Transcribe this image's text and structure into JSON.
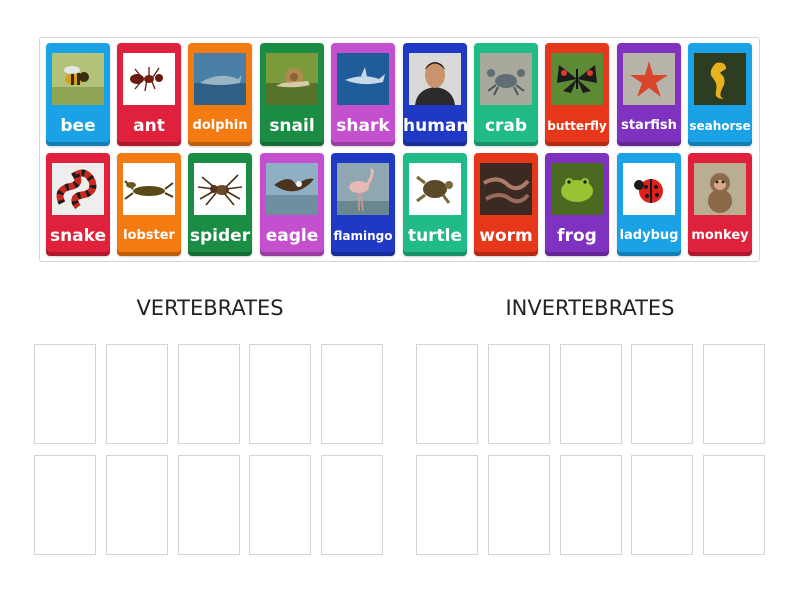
{
  "cards": [
    {
      "label": "bee",
      "color": "#1aa1e6",
      "icon": "bee-photo-icon"
    },
    {
      "label": "ant",
      "color": "#e0213b",
      "icon": "ant-photo-icon"
    },
    {
      "label": "dolphin",
      "color": "#f47a12",
      "icon": "dolphin-photo-icon"
    },
    {
      "label": "snail",
      "color": "#1a8c44",
      "icon": "snail-photo-icon"
    },
    {
      "label": "shark",
      "color": "#c450cf",
      "icon": "shark-photo-icon"
    },
    {
      "label": "human",
      "color": "#1f39c4",
      "icon": "human-photo-icon"
    },
    {
      "label": "crab",
      "color": "#21bc86",
      "icon": "crab-photo-icon"
    },
    {
      "label": "butterfly",
      "color": "#e6371a",
      "icon": "butterfly-photo-icon"
    },
    {
      "label": "starfish",
      "color": "#7f32c0",
      "icon": "starfish-photo-icon"
    },
    {
      "label": "seahorse",
      "color": "#1aa1e6",
      "icon": "seahorse-photo-icon"
    },
    {
      "label": "snake",
      "color": "#e0213b",
      "icon": "snake-photo-icon"
    },
    {
      "label": "lobster",
      "color": "#f47a12",
      "icon": "lobster-photo-icon"
    },
    {
      "label": "spider",
      "color": "#1a8c44",
      "icon": "spider-photo-icon"
    },
    {
      "label": "eagle",
      "color": "#c450cf",
      "icon": "eagle-photo-icon"
    },
    {
      "label": "flamingo",
      "color": "#1f39c4",
      "icon": "flamingo-photo-icon"
    },
    {
      "label": "turtle",
      "color": "#21bc86",
      "icon": "turtle-photo-icon"
    },
    {
      "label": "worm",
      "color": "#e6371a",
      "icon": "worm-photo-icon"
    },
    {
      "label": "frog",
      "color": "#7f32c0",
      "icon": "frog-photo-icon"
    },
    {
      "label": "ladybug",
      "color": "#1aa1e6",
      "icon": "ladybug-photo-icon"
    },
    {
      "label": "monkey",
      "color": "#e0213b",
      "icon": "monkey-photo-icon"
    }
  ],
  "groups": {
    "vertebrates": "VERTEBRATES",
    "invertebrates": "INVERTEBRATES"
  }
}
